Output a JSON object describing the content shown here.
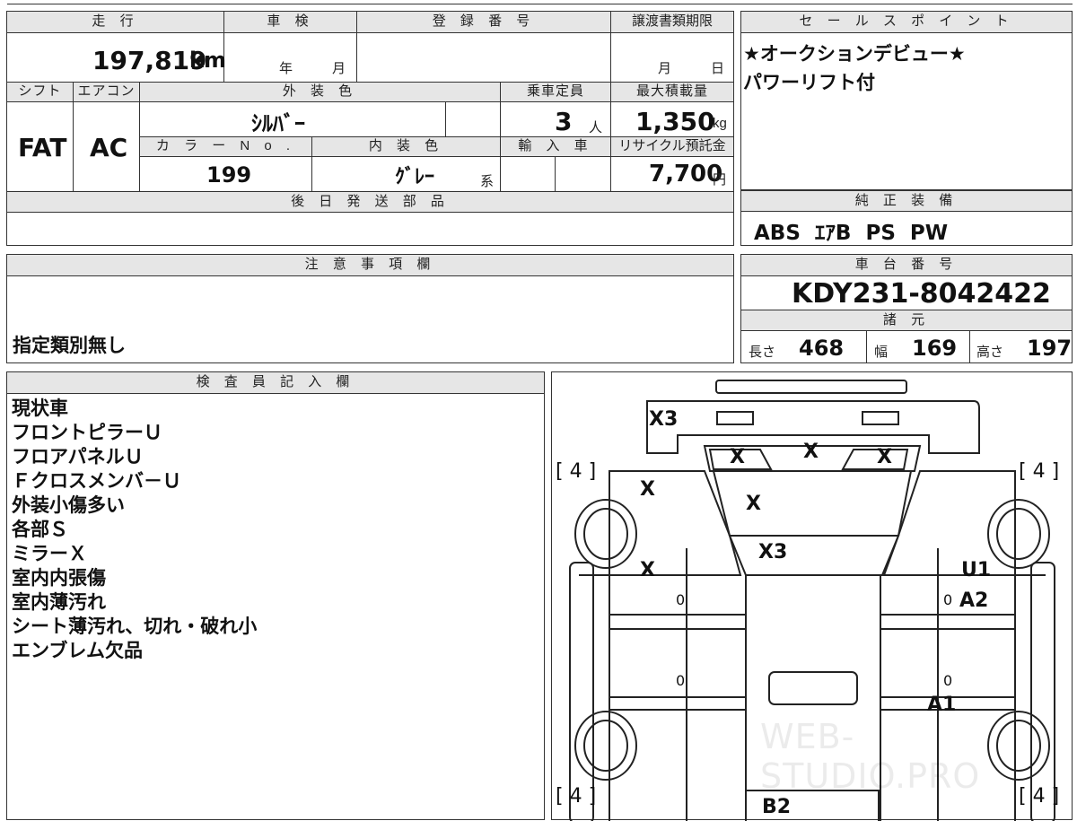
{
  "specs": {
    "mileage_label": "走 行",
    "mileage_value": "197,819",
    "mileage_unit": "km",
    "inspection_label": "車 検",
    "inspection_year_unit": "年",
    "inspection_month_unit": "月",
    "registration_label": "登 録 番 号",
    "transfer_deadline_label": "譲渡書類期限",
    "transfer_month_unit": "月",
    "transfer_day_unit": "日",
    "shift_label": "シフト",
    "shift_value": "FAT",
    "ac_label": "エアコン",
    "ac_value": "AC",
    "exterior_color_label": "外 装 色",
    "exterior_color_value": "ｼﾙﾊﾞｰ",
    "capacity_label": "乗車定員",
    "capacity_value": "3",
    "capacity_unit": "人",
    "max_load_label": "最大積載量",
    "max_load_value": "1,350",
    "max_load_unit": "kg",
    "color_no_label": "カ ラ ー N o .",
    "color_no_value": "199",
    "interior_color_label": "内 装 色",
    "interior_color_value": "ｸﾞﾚｰ",
    "interior_color_suffix": "系",
    "import_label": "輸 入 車",
    "recycle_label": "リサイクル預託金",
    "recycle_value": "7,700",
    "recycle_unit": "円",
    "later_parts_label": "後 日 発 送 部 品"
  },
  "sales_points": {
    "label": "セ ー ル ス ポ イ ン ト",
    "lines": [
      "★オークションデビュー★",
      "パワーリフト付"
    ]
  },
  "equipment": {
    "label": "純 正 装 備",
    "value": "ABS  ｴｱB  PS  PW"
  },
  "notes": {
    "label": "注 意 事 項 欄",
    "text": "指定類別無し"
  },
  "chassis": {
    "label": "車 台 番 号",
    "value": "KDY231-8042422",
    "dims_label": "諸 元",
    "length_label": "長さ",
    "length_value": "468",
    "width_label": "幅",
    "width_value": "169",
    "height_label": "高さ",
    "height_value": "197"
  },
  "inspector": {
    "label": "検 査 員 記 入 欄",
    "lines": [
      "現状車",
      "フロントピラーＵ",
      "フロアパネルＵ",
      "Ｆクロスメンバ－Ｕ",
      "外装小傷多い",
      "各部Ｓ",
      "ミラーＸ",
      "室内内張傷",
      "室内薄汚れ",
      "シート薄汚れ、切れ・破れ小",
      "エンブレム欠品"
    ]
  },
  "diagram": {
    "tire_fl": "[ 4 ]",
    "tire_fr": "[ 4 ]",
    "tire_rl": "[ 4 ]",
    "tire_rr": "[ 4 ]",
    "marks": {
      "bumper": "X3",
      "grille_left": "X",
      "grille_center": "X",
      "grille_right": "X",
      "fender_left": "X",
      "hood": "X",
      "windshield": "X3",
      "door_left": "X",
      "pillar_right": "U1",
      "door_right": "A2",
      "rocker_right": "A1",
      "rear_partial": "B2"
    },
    "zeros": [
      "0",
      "0",
      "0",
      "0"
    ],
    "watermark": "WEB-STUDIO.PRO"
  }
}
